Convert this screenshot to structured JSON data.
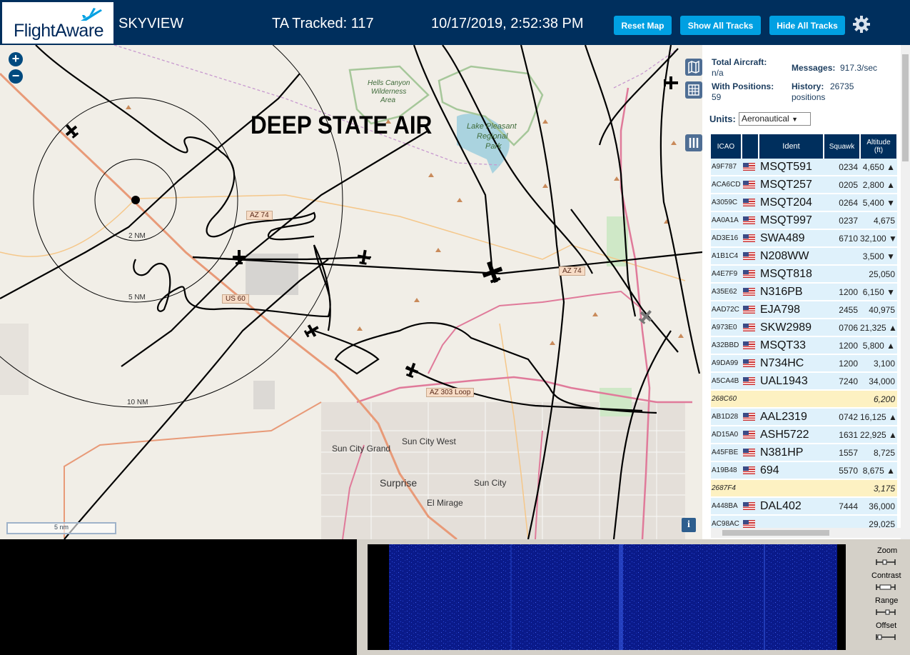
{
  "header": {
    "logo_text": "FlightAware",
    "app_title": "SKYVIEW",
    "ta_tracked": "TA Tracked: 117",
    "datetime": "10/17/2019, 2:52:38 PM",
    "buttons": {
      "reset_map": "Reset Map",
      "show_all_tracks": "Show All Tracks",
      "hide_all_tracks": "Hide All Tracks"
    },
    "settings_icon": "gear-icon"
  },
  "map": {
    "overlay_text": "DEEP STATE AIR",
    "zoom_in": "+",
    "zoom_out": "−",
    "scale_label": "5 nm",
    "info_label": "i",
    "range_rings": [
      "2 NM",
      "5 NM",
      "10 NM"
    ],
    "places": {
      "hells_canyon": "Hells Canyon",
      "wilderness": "Wilderness",
      "area": "Area",
      "lake_pleasant": "Lake Pleasant",
      "regional": "Regional",
      "park": "Park",
      "sun_city_grand": "Sun City Grand",
      "sun_city_west": "Sun City West",
      "surprise": "Surprise",
      "sun_city": "Sun City",
      "el_mirage": "El Mirage"
    },
    "road_signs": {
      "az74_a": "AZ 74",
      "az74_b": "AZ 74",
      "us60": "US 60",
      "az303": "AZ 303 Loop"
    }
  },
  "sidebar": {
    "total_aircraft_label": "Total Aircraft:",
    "total_aircraft_value": "n/a",
    "with_positions_label": "With Positions:",
    "with_positions_value": "59",
    "messages_label": "Messages:",
    "messages_value": "917.3/sec",
    "history_label": "History:",
    "history_value": "26735",
    "history_unit": "positions",
    "units_label": "Units:",
    "units_value": "Aeronautical",
    "columns": {
      "icao": "ICAO",
      "ident": "Ident",
      "squawk": "Squawk",
      "altitude": "Altitude",
      "altitude_unit": "(ft)"
    },
    "rows": [
      {
        "icao": "A9F787",
        "flag": true,
        "ident": "MSQT591",
        "squawk": "0234",
        "alt": "4,650 ▲"
      },
      {
        "icao": "ACA6CD",
        "flag": true,
        "ident": "MSQT257",
        "squawk": "0205",
        "alt": "2,800 ▲"
      },
      {
        "icao": "A3059C",
        "flag": true,
        "ident": "MSQT204",
        "squawk": "0264",
        "alt": "5,400 ▼"
      },
      {
        "icao": "AA0A1A",
        "flag": true,
        "ident": "MSQT997",
        "squawk": "0237",
        "alt": "4,675"
      },
      {
        "icao": "AD3E16",
        "flag": true,
        "ident": "SWA489",
        "squawk": "6710",
        "alt": "32,100 ▼"
      },
      {
        "icao": "A1B1C4",
        "flag": true,
        "ident": "N208WW",
        "squawk": "",
        "alt": "3,500 ▼"
      },
      {
        "icao": "A4E7F9",
        "flag": true,
        "ident": "MSQT818",
        "squawk": "",
        "alt": "25,050"
      },
      {
        "icao": "A35E62",
        "flag": true,
        "ident": "N316PB",
        "squawk": "1200",
        "alt": "6,150 ▼"
      },
      {
        "icao": "AAD72C",
        "flag": true,
        "ident": "EJA798",
        "squawk": "2455",
        "alt": "40,975"
      },
      {
        "icao": "A973E0",
        "flag": true,
        "ident": "SKW2989",
        "squawk": "0706",
        "alt": "21,325 ▲"
      },
      {
        "icao": "A32BBD",
        "flag": true,
        "ident": "MSQT33",
        "squawk": "1200",
        "alt": "5,800 ▲"
      },
      {
        "icao": "A9DA99",
        "flag": true,
        "ident": "N734HC",
        "squawk": "1200",
        "alt": "3,100"
      },
      {
        "icao": "A5CA4B",
        "flag": true,
        "ident": "UAL1943",
        "squawk": "7240",
        "alt": "34,000"
      },
      {
        "icao": "268C60",
        "flag": false,
        "ident": "",
        "squawk": "",
        "alt": "6,200",
        "nopos": true
      },
      {
        "icao": "AB1D28",
        "flag": true,
        "ident": "AAL2319",
        "squawk": "0742",
        "alt": "16,125 ▲"
      },
      {
        "icao": "AD15A0",
        "flag": true,
        "ident": "ASH5722",
        "squawk": "1631",
        "alt": "22,925 ▲"
      },
      {
        "icao": "A45FBE",
        "flag": true,
        "ident": "N381HP",
        "squawk": "1557",
        "alt": "8,725"
      },
      {
        "icao": "A19B48",
        "flag": true,
        "ident": "694",
        "squawk": "5570",
        "alt": "8,675 ▲"
      },
      {
        "icao": "2687F4",
        "flag": false,
        "ident": "",
        "squawk": "",
        "alt": "3,175",
        "nopos": true
      },
      {
        "icao": "A448BA",
        "flag": true,
        "ident": "DAL402",
        "squawk": "7444",
        "alt": "36,000"
      },
      {
        "icao": "AC98AC",
        "flag": true,
        "ident": "",
        "squawk": "",
        "alt": "29,025"
      }
    ]
  },
  "spectrum": {
    "zoom_label": "Zoom",
    "contrast_label": "Contrast",
    "range_label": "Range",
    "offset_label": "Offset"
  },
  "colors": {
    "header_bg": "#002f5d",
    "button_bg": "#00a0e2",
    "row_bg": "#dff1fb",
    "no_position_row_bg": "#fdf1c2"
  }
}
